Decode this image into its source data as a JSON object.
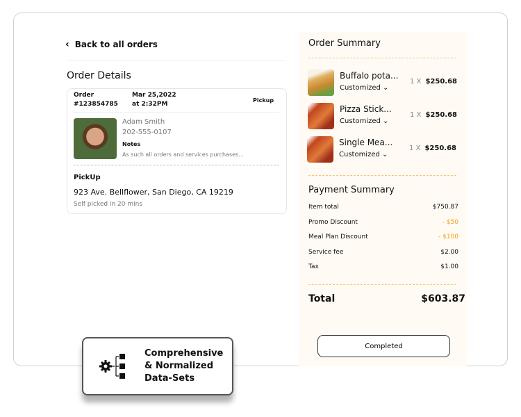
{
  "left": {
    "back_label": "Back to all orders",
    "title": "Order Details",
    "order": {
      "label": "Order",
      "number": "#123854785",
      "date": "Mar 25,2022",
      "time": "at 2:32PM",
      "type": "Pickup",
      "customer_name": "Adam Smith",
      "phone": "202-555-0107",
      "notes_label": "Notes",
      "notes": "As such all orders and services purchases...",
      "pickup_label": "PickUp",
      "address": "923 Ave. Bellflower, San Diego, CA 19219",
      "pickup_status": "Self picked in 20 mins"
    }
  },
  "summary": {
    "title": "Order Summary",
    "items": [
      {
        "name": "Buffalo pota...",
        "option": "Customized",
        "qty": "1 X",
        "price": "$250.68"
      },
      {
        "name": "Pizza Stick...",
        "option": "Customized",
        "qty": "1 X",
        "price": "$250.68"
      },
      {
        "name": "Single Mea...",
        "option": "Customized",
        "qty": "1 X",
        "price": "$250.68"
      }
    ],
    "payment_title": "Payment Summary",
    "rows": [
      {
        "label": "Item total",
        "value": "$750.87"
      },
      {
        "label": "Promo Discount",
        "value": "- $50"
      },
      {
        "label": "Meal Plan Discount",
        "value": "- $100"
      },
      {
        "label": "Service fee",
        "value": "$2.00"
      },
      {
        "label": "Tax",
        "value": "$1.00"
      }
    ],
    "total_label": "Total",
    "total_value": "$603.87",
    "status_button": "Completed"
  },
  "badge": {
    "line1": "Comprehensive",
    "line2": "& Normalized",
    "line3": "Data-Sets"
  },
  "colors": {
    "panel_bg": "#fffaf3",
    "discount": "#f0a020",
    "divider": "#f3c67a"
  }
}
